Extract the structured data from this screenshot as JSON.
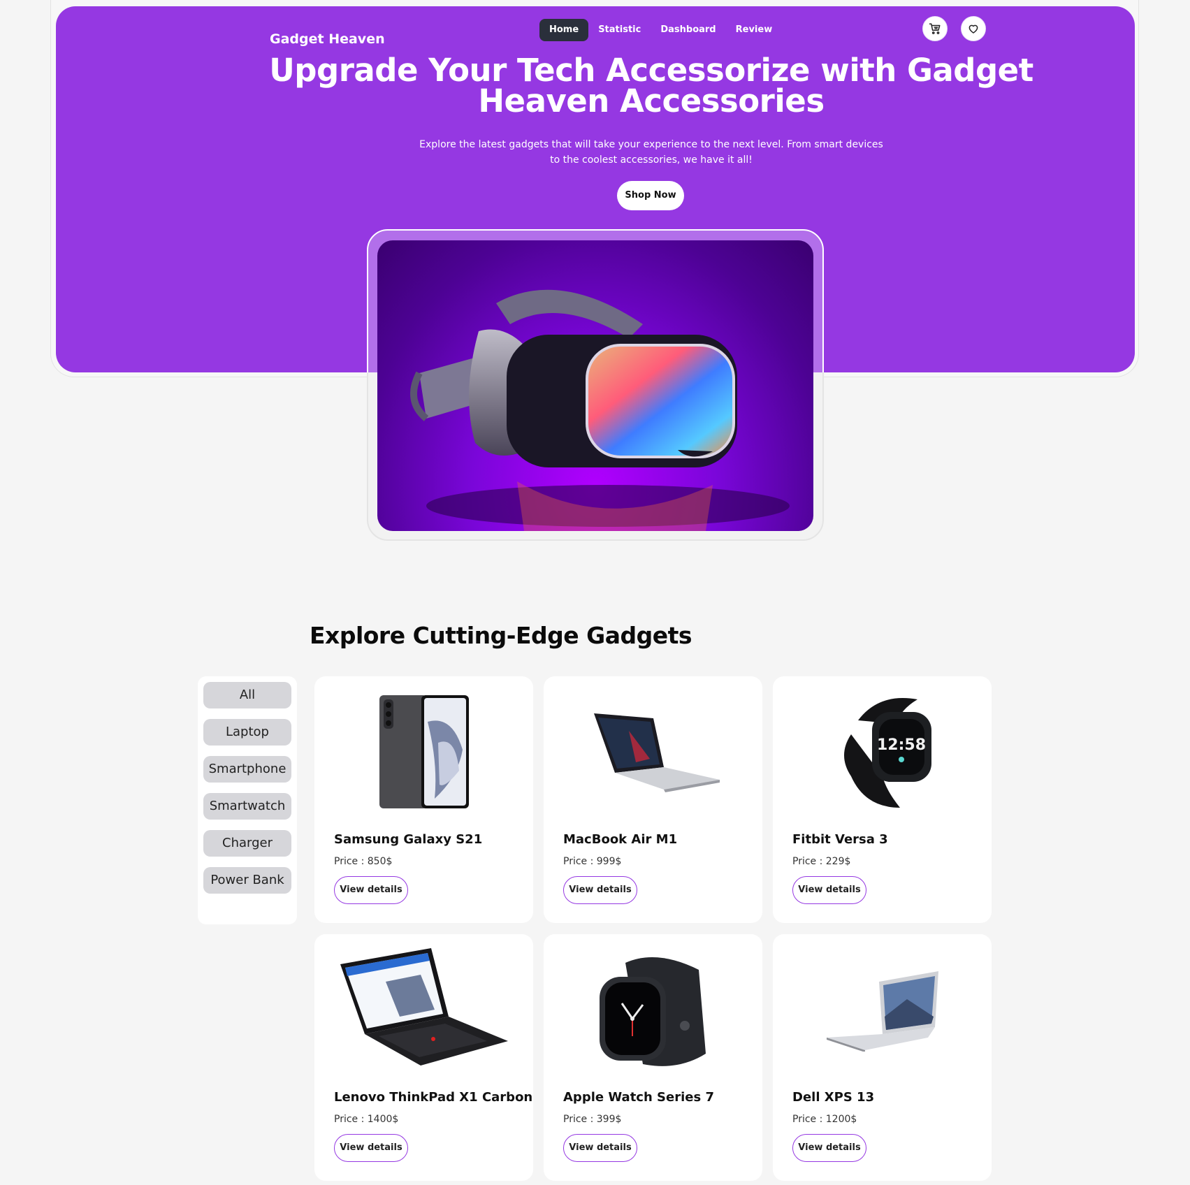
{
  "header": {
    "brand": "Gadget Heaven",
    "nav": [
      "Home",
      "Statistic",
      "Dashboard",
      "Review"
    ],
    "active_nav": "Home",
    "icons": [
      "cart-icon",
      "heart-icon"
    ]
  },
  "hero": {
    "title": "Upgrade Your Tech Accessorize with Gadget Heaven Accessories",
    "description": "Explore the latest gadgets that will take your experience to the next level. From smart devices to the coolest accessories, we have it all!",
    "cta": "Shop Now",
    "banner_image": "vr-headset-image"
  },
  "products_section": {
    "title": "Explore Cutting-Edge Gadgets",
    "categories": [
      "All",
      "Laptop",
      "Smartphone",
      "Smartwatch",
      "Charger",
      "Power Bank"
    ],
    "products": [
      {
        "name": "Samsung Galaxy S21",
        "price": "Price : 850$",
        "button": "View details",
        "image": "smartphone-image"
      },
      {
        "name": "MacBook Air M1",
        "price": "Price : 999$",
        "button": "View details",
        "image": "laptop-image"
      },
      {
        "name": "Fitbit Versa 3",
        "price": "Price : 229$",
        "button": "View details",
        "image": "smartwatch-image"
      },
      {
        "name": "Lenovo ThinkPad X1 Carbon",
        "price": "Price : 1400$",
        "button": "View details",
        "image": "laptop-image"
      },
      {
        "name": "Apple Watch Series 7",
        "price": "Price : 399$",
        "button": "View details",
        "image": "smartwatch-image"
      },
      {
        "name": "Dell XPS 13",
        "price": "Price : 1200$",
        "button": "View details",
        "image": "laptop-image"
      }
    ]
  },
  "watch_face_time": "12:58",
  "colors": {
    "primary": "#9538e2",
    "page_bg": "#f5f5f5",
    "active_nav_bg": "#2a2f3b",
    "category_bg": "#d6d6da"
  }
}
